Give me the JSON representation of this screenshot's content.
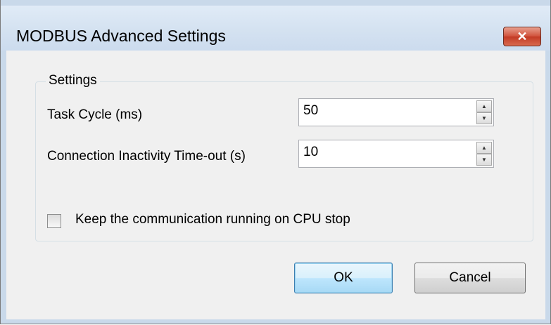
{
  "window": {
    "title": "MODBUS Advanced Settings",
    "close_glyph": "✕"
  },
  "settings_group": {
    "label": "Settings",
    "fields": [
      {
        "label": "Task Cycle (ms)",
        "value": "50"
      },
      {
        "label": "Connection Inactivity Time-out (s)",
        "value": "10"
      }
    ],
    "checkbox": {
      "label": "Keep the communication running on CPU stop",
      "checked": false
    }
  },
  "buttons": {
    "ok": "OK",
    "cancel": "Cancel"
  },
  "icons": {
    "spin_up": "▲",
    "spin_down": "▼"
  }
}
